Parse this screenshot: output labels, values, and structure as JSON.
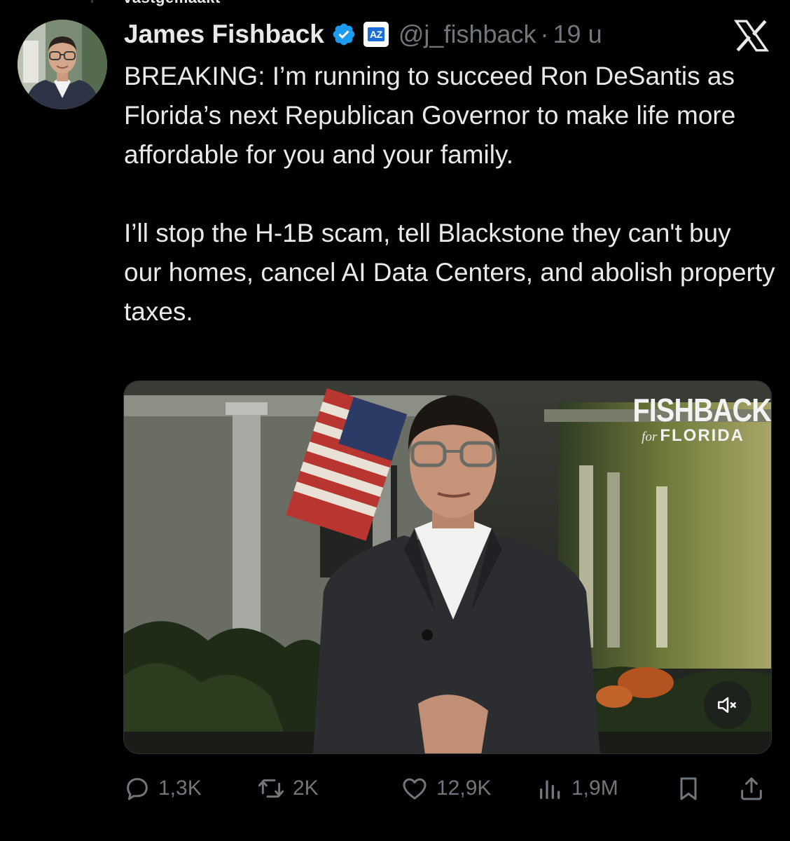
{
  "thread": {
    "cut_off_text": "vastgemaakt"
  },
  "tweet": {
    "author": {
      "name": "James Fishback",
      "handle": "@j_fishback",
      "verified": true,
      "affiliate_badge": "AZ"
    },
    "separator": "·",
    "time": "19 u",
    "text": "BREAKING: I’m running to succeed Ron DeSantis as Florida’s next Republican Governor to make life more affordable for you and your family.\n\nI’ll stop the H-1B scam, tell Blackstone they can't buy our homes, cancel AI Data Centers, and abolish property taxes.",
    "media": {
      "type": "video",
      "brand_title": "FISHBACK",
      "brand_for": "for",
      "brand_state": "FLORIDA",
      "muted": true
    },
    "metrics": {
      "replies": "1,3K",
      "reposts": "2K",
      "likes": "12,9K",
      "views": "1,9M"
    }
  },
  "icons": {
    "verified": "verified-check-icon",
    "x_logo": "x-logo-icon",
    "reply": "reply-icon",
    "repost": "repost-icon",
    "like": "heart-icon",
    "views": "views-chart-icon",
    "bookmark": "bookmark-icon",
    "share": "share-icon",
    "mute": "muted-speaker-icon"
  },
  "colors": {
    "background": "#000000",
    "text_primary": "#e7e9ea",
    "text_secondary": "#71767b",
    "verified_blue": "#1d9bf0"
  }
}
